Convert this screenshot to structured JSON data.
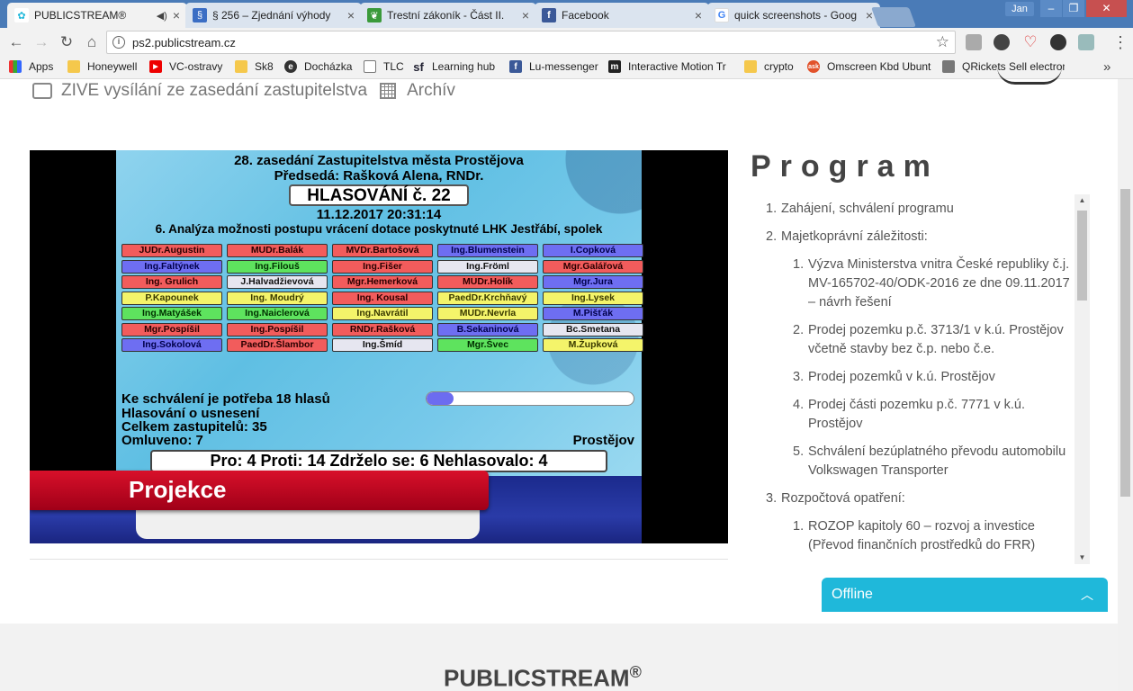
{
  "browser": {
    "tabs": [
      {
        "label": "PUBLICSTREAM®",
        "icon": "publicstream-icon",
        "color": "#1fb8da",
        "audio": true
      },
      {
        "label": "§ 256 – Zjednání výhody",
        "icon": "section-icon",
        "color": "#3b6ec4"
      },
      {
        "label": "Trestní zákoník - Část II.",
        "icon": "leaf-icon",
        "color": "#3a9a3a"
      },
      {
        "label": "Facebook",
        "icon": "facebook-icon",
        "color": "#3b5998"
      },
      {
        "label": "quick screenshots - Goog",
        "icon": "google-icon",
        "color": "#ffffff"
      }
    ],
    "window_user": "Jan",
    "address": "ps2.publicstream.cz",
    "bookmarks": [
      {
        "label": "Apps",
        "icon": "apps-grid-icon"
      },
      {
        "label": "Honeywell",
        "icon": "folder-icon"
      },
      {
        "label": "VC-ostravy",
        "icon": "youtube-icon"
      },
      {
        "label": "Sk8",
        "icon": "folder-icon"
      },
      {
        "label": "Docházka",
        "icon": "e-icon"
      },
      {
        "label": "TLC",
        "icon": "page-icon"
      },
      {
        "label": "Learning hub",
        "icon": "sf-icon"
      },
      {
        "label": "Lu-messenger",
        "icon": "facebook-icon"
      },
      {
        "label": "Interactive Motion Tr",
        "icon": "motion-icon"
      },
      {
        "label": "crypto",
        "icon": "folder-icon"
      },
      {
        "label": "Omscreen Kbd Ubunt",
        "icon": "ask-icon"
      },
      {
        "label": "QRickets Sell electron",
        "icon": "qr-icon"
      }
    ]
  },
  "page": {
    "nav_live": "ZIVE vysílání ze zasedání zastupitelstva",
    "nav_archive": "Archív"
  },
  "slide": {
    "title": "28. zasedání Zastupitelstva města Prostějova",
    "chair": "Předsedá: Rašková Alena, RNDr.",
    "vote_badge": "HLASOVÁNÍ č. 22",
    "datetime": "11.12.2017 20:31:14",
    "topic": "6. Analýza možnosti postupu vrácení dotace poskytnuté LHK Jestřábí, spolek",
    "members": [
      {
        "name": "JUDr.Augustin",
        "vote": "red"
      },
      {
        "name": "MUDr.Balák",
        "vote": "red"
      },
      {
        "name": "MVDr.Bartošová",
        "vote": "red"
      },
      {
        "name": "Ing.Blumenstein",
        "vote": "blue"
      },
      {
        "name": "I.Copková",
        "vote": "blue"
      },
      {
        "name": "Ing.Faltýnek",
        "vote": "blue"
      },
      {
        "name": "Ing.Filouš",
        "vote": "green"
      },
      {
        "name": "Ing.Fišer",
        "vote": "red"
      },
      {
        "name": "Ing.Fröml",
        "vote": "white"
      },
      {
        "name": "Mgr.Galářová",
        "vote": "red"
      },
      {
        "name": "Ing. Grulich",
        "vote": "red"
      },
      {
        "name": "J.Halvadžievová",
        "vote": "white"
      },
      {
        "name": "Mgr.Hemerková",
        "vote": "red"
      },
      {
        "name": "MUDr.Holík",
        "vote": "red"
      },
      {
        "name": "Mgr.Jura",
        "vote": "blue"
      },
      {
        "name": "P.Kapounek",
        "vote": "yellow"
      },
      {
        "name": "Ing. Moudrý",
        "vote": "yellow"
      },
      {
        "name": "Ing. Kousal",
        "vote": "red"
      },
      {
        "name": "PaedDr.Krchňavý",
        "vote": "yellow"
      },
      {
        "name": "Ing.Lysek",
        "vote": "yellow"
      },
      {
        "name": "Ing.Matyášek",
        "vote": "green"
      },
      {
        "name": "Ing.Naiclerová",
        "vote": "green"
      },
      {
        "name": "Ing.Navrátil",
        "vote": "yellow"
      },
      {
        "name": "MUDr.Nevrla",
        "vote": "yellow"
      },
      {
        "name": "M.Pišťák",
        "vote": "blue"
      },
      {
        "name": "Mgr.Pospíšil",
        "vote": "red"
      },
      {
        "name": "Ing.Pospíšil",
        "vote": "red"
      },
      {
        "name": "RNDr.Rašková",
        "vote": "red"
      },
      {
        "name": "B.Sekaninová",
        "vote": "blue"
      },
      {
        "name": "Bc.Smetana",
        "vote": "white"
      },
      {
        "name": "Ing.Sokolová",
        "vote": "blue"
      },
      {
        "name": "PaedDr.Šlambor",
        "vote": "red"
      },
      {
        "name": "Ing.Šmíd",
        "vote": "white"
      },
      {
        "name": "Mgr.Švec",
        "vote": "green"
      },
      {
        "name": "M.Župková",
        "vote": "yellow"
      }
    ],
    "required": "Ke schválení je potřeba 18 hlasů",
    "motion": "Hlasování o usnesení",
    "total": "Celkem zastupitelů: 35",
    "excused": "Omluveno: 7",
    "progress_fraction": 0.13,
    "city": "Prostějov",
    "result": "Pro: 4  Proti: 14  Zdrželo se: 6  Nehlasovalo: 4",
    "lower_third": "Projekce"
  },
  "program": {
    "title": "Program",
    "items": [
      {
        "num": "1.",
        "text": "Zahájení, schválení programu",
        "sub": []
      },
      {
        "num": "2.",
        "text": "Majetkoprávní záležitosti:",
        "sub": [
          {
            "num": "1.",
            "text": "Výzva Ministerstva vnitra České republiky č.j. MV-165702-40/ODK-2016 ze dne 09.11.2017 – návrh řešení"
          },
          {
            "num": "2.",
            "text": "Prodej pozemku p.č. 3713/1 v k.ú. Prostějov včetně stavby bez č.p. nebo č.e."
          },
          {
            "num": "3.",
            "text": "Prodej pozemků v k.ú. Prostějov"
          },
          {
            "num": "4.",
            "text": "Prodej části pozemku p.č. 7771 v k.ú. Prostějov"
          },
          {
            "num": "5.",
            "text": "Schválení bezúplatného převodu automobilu Volkswagen Transporter"
          }
        ]
      },
      {
        "num": "3.",
        "text": "Rozpočtová opatření:",
        "sub": [
          {
            "num": "1.",
            "text": "ROZOP kapitoly 60 – rozvoj a investice (Převod finančních prostředků do FRR)"
          }
        ]
      }
    ]
  },
  "footer": {
    "brand": "PUBLICSTREAM",
    "mark": "®",
    "chat": "Offline"
  }
}
